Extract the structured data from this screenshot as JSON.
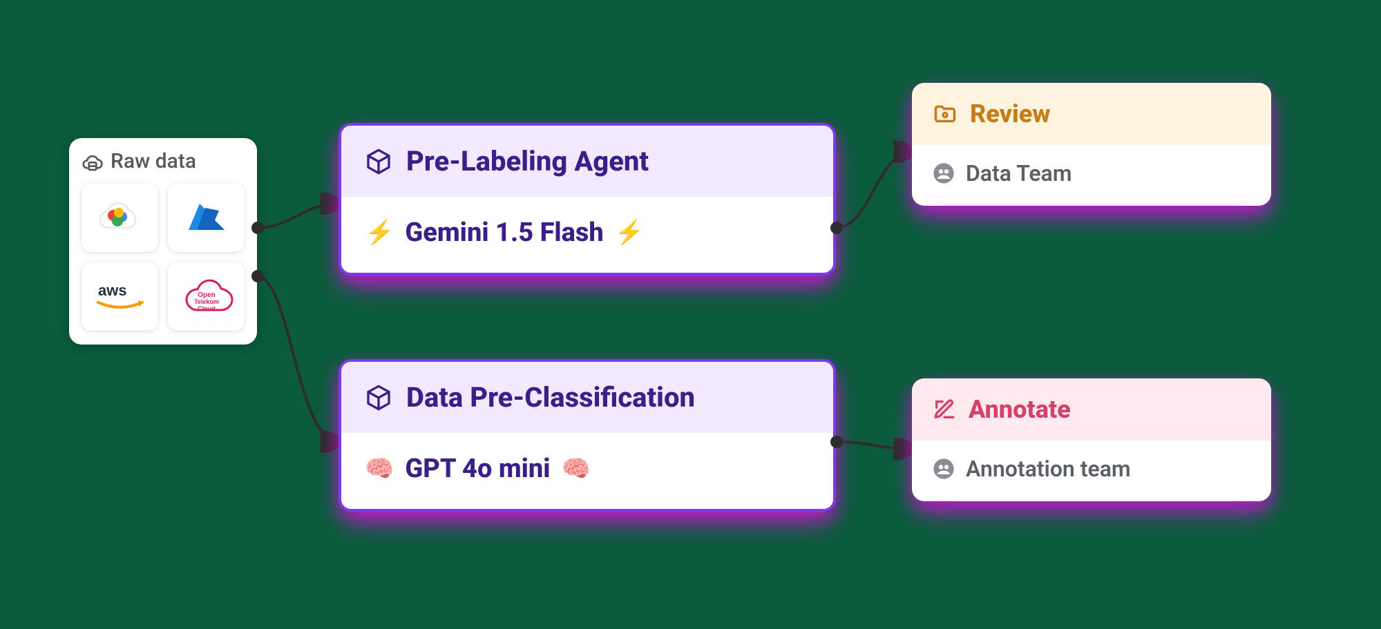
{
  "raw_data": {
    "title": "Raw data",
    "providers": [
      "Google Cloud",
      "Azure",
      "AWS",
      "Open Telekom Cloud"
    ]
  },
  "agents": [
    {
      "title": "Pre-Labeling Agent",
      "model": "Gemini 1.5 Flash",
      "decor": "bolt"
    },
    {
      "title": "Data Pre-Classification",
      "model": "GPT 4o mini",
      "decor": "brain"
    }
  ],
  "tasks": [
    {
      "kind": "review",
      "title": "Review",
      "team": "Data Team",
      "accent": "#c77d17"
    },
    {
      "kind": "annotate",
      "title": "Annotate",
      "team": "Annotation team",
      "accent": "#d4416b"
    }
  ]
}
